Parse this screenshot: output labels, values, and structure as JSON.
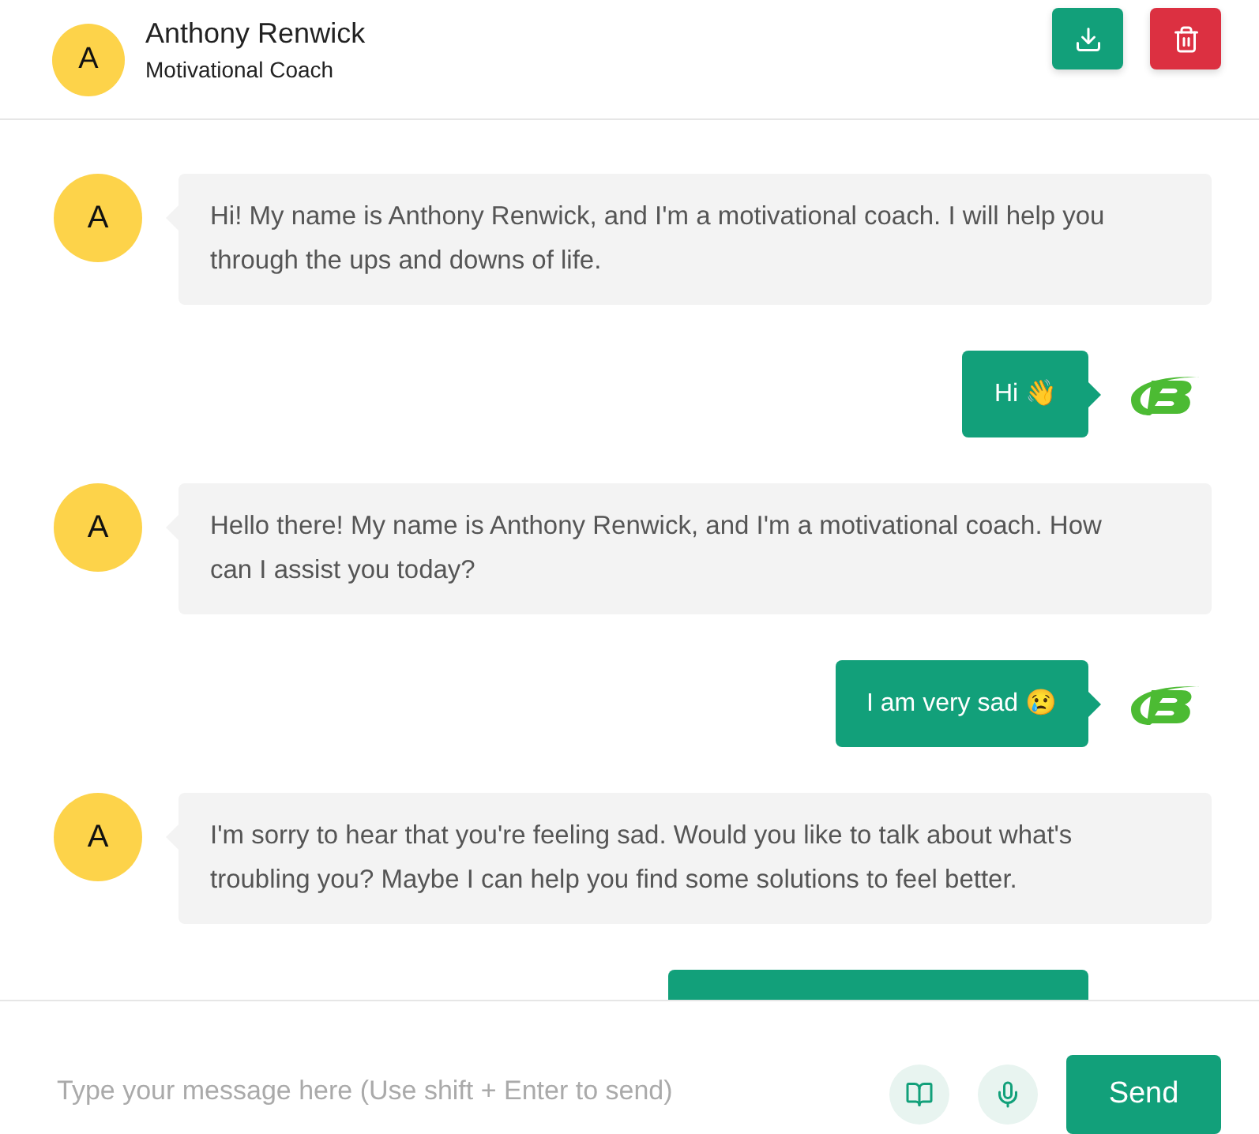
{
  "header": {
    "avatar_letter": "A",
    "name": "Anthony Renwick",
    "subtitle": "Motivational Coach"
  },
  "messages": [
    {
      "kind": "bot",
      "avatar_letter": "A",
      "text": "Hi! My name is Anthony Renwick, and I'm a motivational coach. I will help you through the ups and downs of life."
    },
    {
      "kind": "user",
      "text": "Hi 👋"
    },
    {
      "kind": "bot",
      "avatar_letter": "A",
      "text": "Hello there! My name is Anthony Renwick, and I'm a motivational coach. How can I assist you today?"
    },
    {
      "kind": "user",
      "text": "I am very sad 😢"
    },
    {
      "kind": "bot",
      "avatar_letter": "A",
      "text": "I'm sorry to hear that you're feeling sad. Would you like to talk about what's troubling you? Maybe I can help you find some solutions to feel better."
    },
    {
      "kind": "cut"
    }
  ],
  "composer": {
    "placeholder": "Type your message here (Use shift + Enter to send)",
    "send_label": "Send"
  }
}
